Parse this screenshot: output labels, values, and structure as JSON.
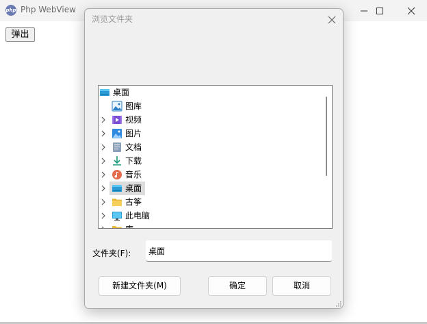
{
  "window": {
    "title": "Php WebView",
    "icon_text": "php",
    "popup_button": "弹出"
  },
  "dialog": {
    "title": "浏览文件夹",
    "folder_label": "文件夹(F):",
    "folder_value": "桌面",
    "new_folder_button": "新建文件夹(M)",
    "ok_button": "确定",
    "cancel_button": "取消"
  },
  "tree": {
    "items": [
      {
        "label": "桌面",
        "icon": "desktop-icon",
        "expandable": false,
        "depth": 0,
        "selected": false
      },
      {
        "label": "图库",
        "icon": "gallery-icon",
        "expandable": false,
        "depth": 1,
        "selected": false
      },
      {
        "label": "视频",
        "icon": "videos-icon",
        "expandable": true,
        "depth": 1,
        "selected": false
      },
      {
        "label": "图片",
        "icon": "pictures-icon",
        "expandable": true,
        "depth": 1,
        "selected": false
      },
      {
        "label": "文档",
        "icon": "documents-icon",
        "expandable": true,
        "depth": 1,
        "selected": false
      },
      {
        "label": "下载",
        "icon": "downloads-icon",
        "expandable": true,
        "depth": 1,
        "selected": false
      },
      {
        "label": "音乐",
        "icon": "music-icon",
        "expandable": true,
        "depth": 1,
        "selected": false
      },
      {
        "label": "桌面",
        "icon": "desktop-icon",
        "expandable": true,
        "depth": 1,
        "selected": true
      },
      {
        "label": "古筝",
        "icon": "folder-icon",
        "expandable": true,
        "depth": 1,
        "selected": false
      },
      {
        "label": "此电脑",
        "icon": "this-pc-icon",
        "expandable": true,
        "depth": 1,
        "selected": false
      },
      {
        "label": "库",
        "icon": "folder-icon",
        "expandable": true,
        "depth": 1,
        "selected": false
      }
    ]
  },
  "colors": {
    "dialog_background": "#f0f0f0",
    "selection": "#dcdcdc",
    "title_gray": "#9a9a9a"
  }
}
